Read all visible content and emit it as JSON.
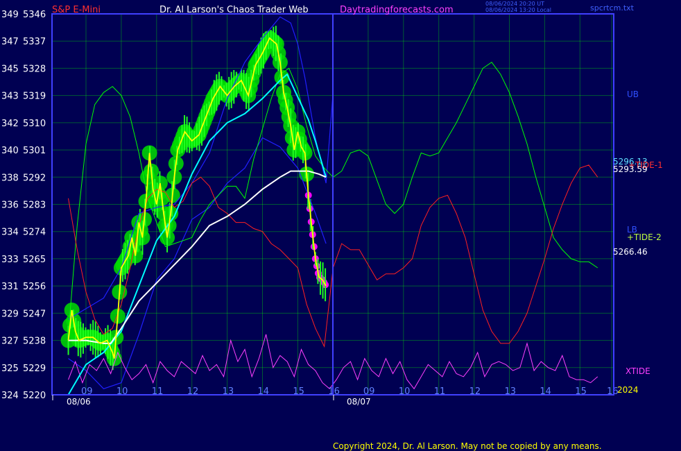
{
  "header": {
    "instrument": "S&P E-Mini",
    "site_title": "Dr. Al Larson's Chaos Trader Web",
    "site_url": "Daytradingforecasts.com",
    "time_ut": "08/06/2024 20:20 UT",
    "time_local": "08/06/2024 13:20 Local",
    "filename": "spcrtcm.txt"
  },
  "footer": {
    "copyright": "Copyright 2024, Dr. Al Larson. May not be copied by any means."
  },
  "colors": {
    "background": "#000052",
    "grid": "#00ff00",
    "axis": "#4040ff",
    "price": "#ffff00",
    "bars": "#00ff00",
    "halo": "#00dd00",
    "magenta": "#ff00ff",
    "cyan_ma": "#00ffff",
    "white_ma": "#ffffff",
    "ub_lb": "#2020ff",
    "red_tide": "#ff2020",
    "green_tide": "#00ff00",
    "xtide": "#ff40ff"
  },
  "chart_data": {
    "type": "line",
    "title": "S&P E-Mini",
    "ylim": [
      5220,
      5346
    ],
    "y_ticks": [
      {
        "left": "324",
        "right": "5220"
      },
      {
        "left": "325",
        "right": "5229"
      },
      {
        "left": "327",
        "right": "5238"
      },
      {
        "left": "329",
        "right": "5247"
      },
      {
        "left": "331",
        "right": "5256"
      },
      {
        "left": "333",
        "right": "5265"
      },
      {
        "left": "334",
        "right": "5274"
      },
      {
        "left": "336",
        "right": "5283"
      },
      {
        "left": "338",
        "right": "5292"
      },
      {
        "left": "340",
        "right": "5301"
      },
      {
        "left": "342",
        "right": "5310"
      },
      {
        "left": "343",
        "right": "5319"
      },
      {
        "left": "345",
        "right": "5328"
      },
      {
        "left": "347",
        "right": "5337"
      },
      {
        "left": "349",
        "right": "5346"
      }
    ],
    "x_ticks": [
      "09",
      "10",
      "11",
      "12",
      "13",
      "14",
      "15",
      "16",
      "09",
      "10",
      "11",
      "12",
      "13",
      "14",
      "15",
      "16"
    ],
    "dates": [
      "08/06",
      "08/07"
    ],
    "series": [
      {
        "name": "price",
        "x": [
          8.5,
          8.6,
          8.7,
          8.8,
          9.0,
          9.2,
          9.4,
          9.6,
          9.75,
          9.8,
          9.9,
          10.0,
          10.2,
          10.3,
          10.4,
          10.5,
          10.6,
          10.7,
          10.8,
          10.9,
          11.0,
          11.1,
          11.2,
          11.3,
          11.4,
          11.5,
          11.6,
          11.8,
          12.0,
          12.2,
          12.4,
          12.6,
          12.8,
          13.0,
          13.2,
          13.4,
          13.6,
          13.8,
          14.0,
          14.2,
          14.4,
          14.5,
          14.6,
          14.7,
          14.8,
          14.9,
          15.0,
          15.1,
          15.2,
          15.3,
          15.4,
          15.5,
          15.6,
          15.7,
          15.8
        ],
        "values": [
          5238,
          5248,
          5241,
          5238,
          5239,
          5239,
          5237,
          5238,
          5234,
          5232,
          5246,
          5262,
          5266,
          5272,
          5266,
          5277,
          5272,
          5284,
          5300,
          5288,
          5283,
          5290,
          5280,
          5272,
          5280,
          5292,
          5301,
          5307,
          5304,
          5306,
          5312,
          5318,
          5322,
          5319,
          5322,
          5324,
          5319,
          5329,
          5333,
          5338,
          5336,
          5330,
          5320,
          5315,
          5309,
          5301,
          5307,
          5302,
          5300,
          5286,
          5275,
          5265,
          5259,
          5258,
          5256
        ]
      },
      {
        "name": "UB",
        "x": [
          8.5,
          9.5,
          10.0,
          10.5,
          11.0,
          11.5,
          12.0,
          12.5,
          13.0,
          13.5,
          14.0,
          14.5,
          14.8,
          15.0,
          15.2,
          15.5,
          15.8,
          16.0
        ],
        "values": [
          5245,
          5252,
          5262,
          5280,
          5282,
          5283,
          5290,
          5300,
          5318,
          5330,
          5338,
          5345,
          5343,
          5336,
          5325,
          5305,
          5290,
          5320
        ]
      },
      {
        "name": "LB",
        "x": [
          8.5,
          9.0,
          9.5,
          10.0,
          10.5,
          11.0,
          11.5,
          12.0,
          12.5,
          13.0,
          13.5,
          14.0,
          14.5,
          15.0,
          15.5,
          15.8
        ],
        "values": [
          5232,
          5228,
          5222,
          5224,
          5240,
          5258,
          5265,
          5278,
          5282,
          5290,
          5295,
          5305,
          5302,
          5295,
          5280,
          5270
        ]
      },
      {
        "name": "cyan_ma",
        "x": [
          8.5,
          9.0,
          9.5,
          10.0,
          10.5,
          11.0,
          11.5,
          12.0,
          12.5,
          13.0,
          13.5,
          14.0,
          14.5,
          14.7,
          14.9,
          15.1,
          15.3,
          15.5,
          15.7,
          15.8
        ],
        "values": [
          5220,
          5230,
          5234,
          5241,
          5256,
          5271,
          5279,
          5293,
          5304,
          5310,
          5313,
          5318,
          5324,
          5326,
          5321,
          5316,
          5311,
          5304,
          5296,
          5292
        ]
      },
      {
        "name": "white_ma",
        "x": [
          8.5,
          9.0,
          9.5,
          9.7,
          10.0,
          10.5,
          11.0,
          11.5,
          12.0,
          12.5,
          13.0,
          13.5,
          14.0,
          14.5,
          14.8,
          15.0,
          15.3,
          15.6,
          15.8
        ],
        "values": [
          5238,
          5238,
          5237,
          5237,
          5242,
          5251,
          5257,
          5263,
          5269,
          5276,
          5279,
          5283,
          5288,
          5292,
          5294,
          5294,
          5294,
          5293,
          5292
        ]
      },
      {
        "name": "green_tide",
        "x": [
          8.5,
          8.75,
          9.0,
          9.25,
          9.5,
          9.75,
          10.0,
          10.25,
          10.5,
          10.75,
          11.0,
          11.25,
          11.5,
          11.75,
          12.0,
          12.25,
          12.5,
          12.75,
          13.0,
          13.25,
          13.5,
          13.75,
          14.0,
          14.25,
          14.5,
          14.75,
          15.0,
          15.25,
          15.5,
          15.75,
          16.0,
          16.25,
          16.5,
          16.75,
          17.0,
          17.25,
          17.5,
          17.75,
          18.0,
          18.25,
          18.5,
          18.75,
          19.0,
          19.25,
          19.5,
          19.75,
          20.0,
          20.25,
          20.5,
          20.75,
          21.0,
          21.25,
          21.5,
          21.75,
          22.0,
          22.25,
          22.5,
          22.75,
          23.0,
          23.25,
          23.5
        ],
        "values": [
          5240,
          5276,
          5303,
          5316,
          5320,
          5322,
          5319,
          5312,
          5300,
          5285,
          5277,
          5269,
          5270,
          5271,
          5272,
          5278,
          5283,
          5286,
          5289,
          5289,
          5285,
          5298,
          5308,
          5318,
          5326,
          5328,
          5321,
          5309,
          5299,
          5295,
          5292,
          5294,
          5300,
          5301,
          5299,
          5291,
          5283,
          5280,
          5283,
          5292,
          5300,
          5299,
          5300,
          5305,
          5310,
          5316,
          5322,
          5328,
          5330,
          5326,
          5320,
          5312,
          5303,
          5292,
          5282,
          5272,
          5268,
          5265,
          5264,
          5264,
          5262
        ]
      },
      {
        "name": "red_tide",
        "x": [
          8.5,
          8.75,
          9.0,
          9.25,
          9.5,
          9.75,
          10.0,
          10.25,
          10.5,
          10.75,
          11.0,
          11.25,
          11.5,
          11.75,
          12.0,
          12.25,
          12.5,
          12.75,
          13.0,
          13.25,
          13.5,
          13.75,
          14.0,
          14.25,
          14.5,
          14.75,
          15.0,
          15.25,
          15.5,
          15.75,
          16.0,
          16.25,
          16.5,
          16.75,
          17.0,
          17.25,
          17.5,
          17.75,
          18.0,
          18.25,
          18.5,
          18.75,
          19.0,
          19.25,
          19.5,
          19.75,
          20.0,
          20.25,
          20.5,
          20.75,
          21.0,
          21.25,
          21.5,
          21.75,
          22.0,
          22.25,
          22.5,
          22.75,
          23.0,
          23.25,
          23.5
        ],
        "values": [
          5285,
          5268,
          5254,
          5245,
          5240,
          5242,
          5250,
          5262,
          5276,
          5285,
          5288,
          5287,
          5282,
          5284,
          5290,
          5292,
          5289,
          5282,
          5280,
          5277,
          5277,
          5275,
          5274,
          5270,
          5268,
          5265,
          5262,
          5250,
          5242,
          5236,
          5262,
          5270,
          5268,
          5268,
          5263,
          5258,
          5260,
          5260,
          5262,
          5265,
          5276,
          5282,
          5285,
          5286,
          5280,
          5272,
          5260,
          5248,
          5241,
          5237,
          5237,
          5241,
          5247,
          5256,
          5265,
          5275,
          5283,
          5290,
          5295,
          5296,
          5292
        ]
      },
      {
        "name": "xtide",
        "x": [
          8.5,
          8.7,
          8.9,
          9.1,
          9.3,
          9.5,
          9.7,
          9.9,
          10.1,
          10.3,
          10.5,
          10.7,
          10.9,
          11.1,
          11.3,
          11.5,
          11.7,
          11.9,
          12.1,
          12.3,
          12.5,
          12.7,
          12.9,
          13.1,
          13.3,
          13.5,
          13.7,
          13.9,
          14.1,
          14.3,
          14.5,
          14.7,
          14.9,
          15.1,
          15.3,
          15.5,
          15.7,
          15.9,
          16.1,
          16.3,
          16.5,
          16.7,
          16.9,
          17.1,
          17.3,
          17.5,
          17.7,
          17.9,
          18.1,
          18.3,
          18.5,
          18.7,
          18.9,
          19.1,
          19.3,
          19.5,
          19.7,
          19.9,
          20.1,
          20.3,
          20.5,
          20.7,
          20.9,
          21.1,
          21.3,
          21.5,
          21.7,
          21.9,
          22.1,
          22.3,
          22.5,
          22.7,
          22.9,
          23.1,
          23.3,
          23.5
        ],
        "values": [
          5225,
          5231,
          5224,
          5230,
          5228,
          5232,
          5227,
          5234,
          5229,
          5225,
          5227,
          5230,
          5224,
          5231,
          5228,
          5226,
          5231,
          5229,
          5227,
          5233,
          5228,
          5230,
          5226,
          5238,
          5231,
          5235,
          5226,
          5232,
          5240,
          5229,
          5233,
          5231,
          5226,
          5235,
          5230,
          5228,
          5224,
          5222,
          5225,
          5229,
          5231,
          5225,
          5232,
          5228,
          5226,
          5232,
          5227,
          5231,
          5225,
          5222,
          5226,
          5230,
          5228,
          5226,
          5231,
          5227,
          5226,
          5229,
          5234,
          5226,
          5230,
          5231,
          5230,
          5228,
          5229,
          5237,
          5228,
          5231,
          5229,
          5228,
          5233,
          5226,
          5225,
          5225,
          5224,
          5226
        ]
      }
    ],
    "labels": {
      "ub": "UB",
      "lb": "LB",
      "xtide": "XTIDE",
      "value_cyan": "5296.13",
      "value_red": "5293.59",
      "value_green": "5266.46",
      "tide1": "+TIDE-1",
      "tide2": "+TIDE-2",
      "year": "2024"
    }
  }
}
